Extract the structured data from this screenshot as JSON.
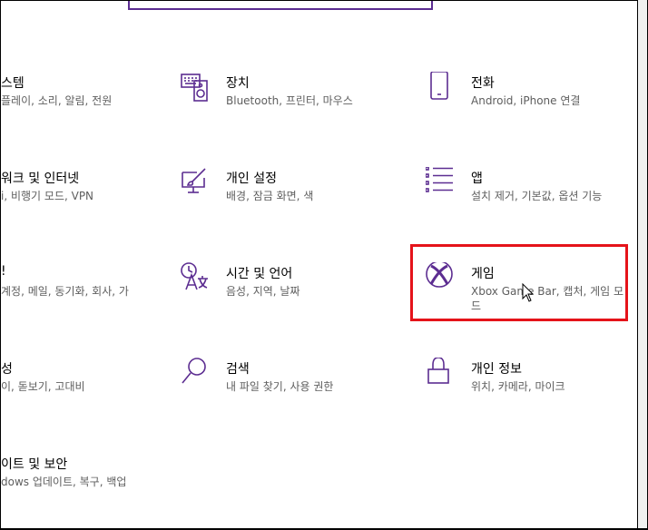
{
  "accent_color": "#5c2d91",
  "highlight_color": "#e5131a",
  "tiles": [
    {
      "id": "system",
      "title": "스템",
      "desc": "플레이, 소리, 알림, 전원",
      "icon": "none"
    },
    {
      "id": "devices",
      "title": "장치",
      "desc": "Bluetooth, 프린터, 마우스",
      "icon": "keyboard-speaker-icon"
    },
    {
      "id": "phone",
      "title": "전화",
      "desc": "Android, iPhone 연결",
      "icon": "phone-icon"
    },
    {
      "id": "network",
      "title": "워크 및 인터넷",
      "desc": "i, 비행기 모드, VPN",
      "icon": "none"
    },
    {
      "id": "personalization",
      "title": "개인 설정",
      "desc": "배경, 잠금 화면, 색",
      "icon": "paint-brush-monitor-icon"
    },
    {
      "id": "apps",
      "title": "앱",
      "desc": "설치 제거, 기본값, 옵션 기능",
      "icon": "app-list-icon"
    },
    {
      "id": "accounts",
      "title": "!",
      "desc": "계정, 메일, 동기화, 회사, 가",
      "icon": "none"
    },
    {
      "id": "time-language",
      "title": "시간 및 언어",
      "desc": "음성, 지역, 날짜",
      "icon": "time-language-icon"
    },
    {
      "id": "gaming",
      "title": "게임",
      "desc": "Xbox Game Bar, 캡처, 게임 모드",
      "icon": "xbox-icon"
    },
    {
      "id": "ease-of-access",
      "title": "성",
      "desc": "이, 돋보기, 고대비",
      "icon": "none"
    },
    {
      "id": "search",
      "title": "검색",
      "desc": "내 파일 찾기, 사용 권한",
      "icon": "search-icon"
    },
    {
      "id": "privacy",
      "title": "개인 정보",
      "desc": "위치, 카메라, 마이크",
      "icon": "lock-icon"
    },
    {
      "id": "update-security",
      "title": "이트 및 보안",
      "desc": "dows 업데이트, 복구, 백업",
      "icon": "none"
    }
  ]
}
